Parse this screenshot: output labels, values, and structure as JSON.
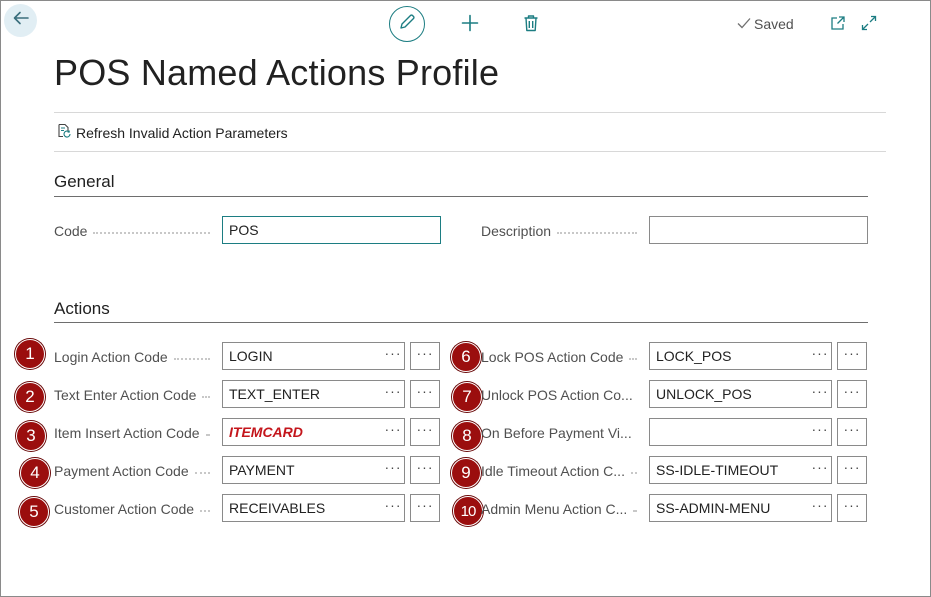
{
  "toolbar": {
    "saved_label": "Saved"
  },
  "page": {
    "title": "POS Named Actions Profile"
  },
  "actions_bar": {
    "refresh_label": "Refresh Invalid Action Parameters"
  },
  "general": {
    "title": "General",
    "code": {
      "label": "Code",
      "value": "POS"
    },
    "description": {
      "label": "Description",
      "value": ""
    }
  },
  "actions": {
    "title": "Actions",
    "more_glyph": "···",
    "left": [
      {
        "badge": "1",
        "label": "Login Action Code",
        "value": "LOGIN",
        "invalid": false
      },
      {
        "badge": "2",
        "label": "Text Enter Action Code",
        "value": "TEXT_ENTER",
        "invalid": false
      },
      {
        "badge": "3",
        "label": "Item Insert Action Code",
        "value": "ITEMCARD",
        "invalid": true
      },
      {
        "badge": "4",
        "label": "Payment Action Code",
        "value": "PAYMENT",
        "invalid": false
      },
      {
        "badge": "5",
        "label": "Customer Action Code",
        "value": "RECEIVABLES",
        "invalid": false
      }
    ],
    "right": [
      {
        "badge": "6",
        "label": "Lock POS Action Code",
        "value": "LOCK_POS",
        "invalid": false
      },
      {
        "badge": "7",
        "label": "Unlock POS Action Co...",
        "value": "UNLOCK_POS",
        "invalid": false
      },
      {
        "badge": "8",
        "label": "On Before Payment Vi...",
        "value": "",
        "invalid": false
      },
      {
        "badge": "9",
        "label": "Idle Timeout Action C...",
        "value": "SS-IDLE-TIMEOUT",
        "invalid": false
      },
      {
        "badge": "10",
        "label": "Admin Menu Action C...",
        "value": "SS-ADMIN-MENU",
        "invalid": false
      }
    ]
  },
  "colors": {
    "accent": "#1c7d82",
    "badge": "#9b0e0e",
    "error_text": "#c4161c"
  }
}
